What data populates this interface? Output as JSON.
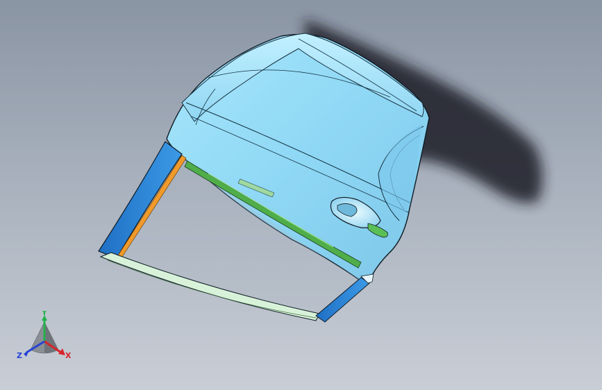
{
  "viewport": {
    "background_top": "#8a95a4",
    "background_bottom": "#c9ced6"
  },
  "model": {
    "panel_color": "#8fd8f5",
    "panel_highlight": "#b6ecff",
    "seal_color": "#2e86d9",
    "trim_orange": "#f09a2b",
    "strip_green": "#4fae4a",
    "frame_color": "#d7f2d9",
    "shadow_color": "#1b1f26"
  },
  "triad": {
    "x_label": "X",
    "y_label": "Y",
    "z_label": "Z",
    "x_color": "#d8232a",
    "y_color": "#24b24b",
    "z_color": "#2742d6",
    "base_icon": "triad-cone-icon"
  }
}
